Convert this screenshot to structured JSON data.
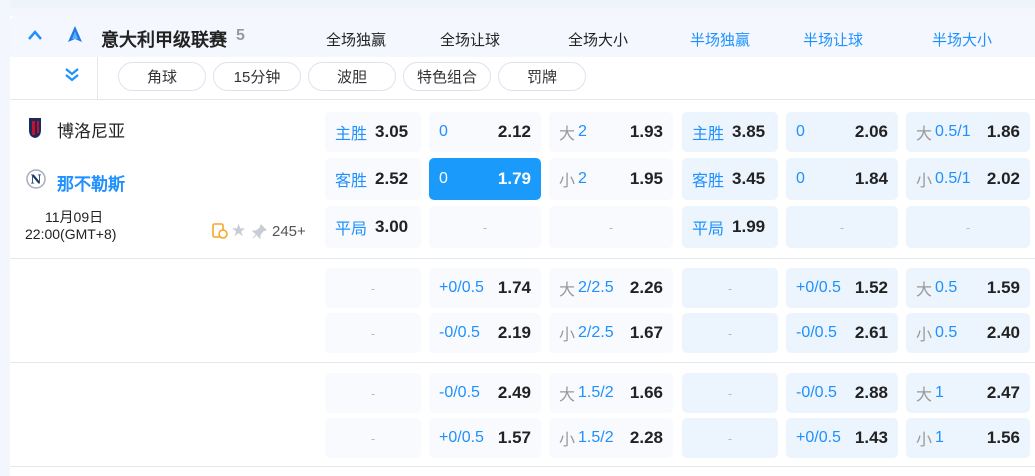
{
  "league": {
    "name": "意大利甲级联赛",
    "count": "5",
    "icon": "serie-a-logo-icon"
  },
  "columns": [
    {
      "label": "全场独赢",
      "half": false
    },
    {
      "label": "全场让球",
      "half": false
    },
    {
      "label": "全场大小",
      "half": false
    },
    {
      "label": "半场独赢",
      "half": true
    },
    {
      "label": "半场让球",
      "half": true
    },
    {
      "label": "半场大小",
      "half": true
    }
  ],
  "filters": [
    "角球",
    "15分钟",
    "波胆",
    "特色组合",
    "罚牌"
  ],
  "match": {
    "home": "博洛尼亚",
    "away": "那不勒斯",
    "date": "11月09日",
    "time": "22:00(GMT+8)",
    "more": "245+"
  },
  "colors": {
    "accent": "#1e90ff",
    "selected": "#1a9bfc"
  },
  "rows": [
    [
      {
        "lab": "主胜",
        "odds": "3.05"
      },
      {
        "lab": "0",
        "odds": "2.12"
      },
      {
        "pre": "大",
        "lab": "2",
        "odds": "1.93"
      },
      {
        "lab": "主胜",
        "odds": "3.85"
      },
      {
        "lab": "0",
        "odds": "2.06"
      },
      {
        "pre": "大",
        "lab": "0.5/1",
        "odds": "1.86"
      }
    ],
    [
      {
        "lab": "客胜",
        "odds": "2.52"
      },
      {
        "lab": "0",
        "odds": "1.79",
        "selected": true
      },
      {
        "pre": "小",
        "lab": "2",
        "odds": "1.95"
      },
      {
        "lab": "客胜",
        "odds": "3.45"
      },
      {
        "lab": "0",
        "odds": "1.84"
      },
      {
        "pre": "小",
        "lab": "0.5/1",
        "odds": "2.02"
      }
    ],
    [
      {
        "lab": "平局",
        "odds": "3.00"
      },
      null,
      null,
      {
        "lab": "平局",
        "odds": "1.99"
      },
      null,
      null
    ],
    [
      null,
      {
        "lab": "+0/0.5",
        "odds": "1.74"
      },
      {
        "pre": "大",
        "lab": "2/2.5",
        "odds": "2.26"
      },
      null,
      {
        "lab": "+0/0.5",
        "odds": "1.52"
      },
      {
        "pre": "大",
        "lab": "0.5",
        "odds": "1.59"
      }
    ],
    [
      null,
      {
        "lab": "-0/0.5",
        "odds": "2.19"
      },
      {
        "pre": "小",
        "lab": "2/2.5",
        "odds": "1.67"
      },
      null,
      {
        "lab": "-0/0.5",
        "odds": "2.61"
      },
      {
        "pre": "小",
        "lab": "0.5",
        "odds": "2.40"
      }
    ],
    [
      null,
      {
        "lab": "-0/0.5",
        "odds": "2.49"
      },
      {
        "pre": "大",
        "lab": "1.5/2",
        "odds": "1.66"
      },
      null,
      {
        "lab": "-0/0.5",
        "odds": "2.88"
      },
      {
        "pre": "大",
        "lab": "1",
        "odds": "2.47"
      }
    ],
    [
      null,
      {
        "lab": "+0/0.5",
        "odds": "1.57"
      },
      {
        "pre": "小",
        "lab": "1.5/2",
        "odds": "2.28"
      },
      null,
      {
        "lab": "+0/0.5",
        "odds": "1.43"
      },
      {
        "pre": "小",
        "lab": "1",
        "odds": "1.56"
      }
    ]
  ],
  "empty": "-"
}
